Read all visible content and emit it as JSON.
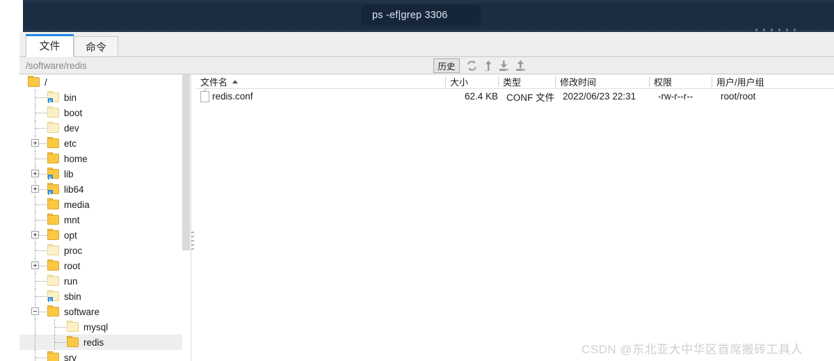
{
  "terminal": {
    "tab_title": "ps -ef|grep 3306"
  },
  "tabs": [
    {
      "id": "files",
      "label": "文件",
      "active": true
    },
    {
      "id": "commands",
      "label": "命令",
      "active": false
    }
  ],
  "toolbar": {
    "path_value": "/software/redis",
    "path_placeholder": "/software/redis",
    "history_label": "历史",
    "icons": [
      {
        "name": "refresh-icon",
        "title": "刷新"
      },
      {
        "name": "parent-directory-icon",
        "title": "上级目录"
      },
      {
        "name": "download-icon",
        "title": "下载"
      },
      {
        "name": "upload-icon",
        "title": "上传"
      }
    ]
  },
  "tree": {
    "items": [
      {
        "label": "/",
        "depth": 0,
        "expander": "none",
        "folder": "solid",
        "link": false,
        "selected": false
      },
      {
        "label": "bin",
        "depth": 1,
        "expander": "none",
        "folder": "pale",
        "link": true,
        "selected": false
      },
      {
        "label": "boot",
        "depth": 1,
        "expander": "none",
        "folder": "pale",
        "link": false,
        "selected": false
      },
      {
        "label": "dev",
        "depth": 1,
        "expander": "none",
        "folder": "pale",
        "link": false,
        "selected": false
      },
      {
        "label": "etc",
        "depth": 1,
        "expander": "plus",
        "folder": "solid",
        "link": false,
        "selected": false
      },
      {
        "label": "home",
        "depth": 1,
        "expander": "none",
        "folder": "solid",
        "link": false,
        "selected": false
      },
      {
        "label": "lib",
        "depth": 1,
        "expander": "plus",
        "folder": "solid",
        "link": true,
        "selected": false
      },
      {
        "label": "lib64",
        "depth": 1,
        "expander": "plus",
        "folder": "solid",
        "link": true,
        "selected": false
      },
      {
        "label": "media",
        "depth": 1,
        "expander": "none",
        "folder": "solid",
        "link": false,
        "selected": false
      },
      {
        "label": "mnt",
        "depth": 1,
        "expander": "none",
        "folder": "solid",
        "link": false,
        "selected": false
      },
      {
        "label": "opt",
        "depth": 1,
        "expander": "plus",
        "folder": "solid",
        "link": false,
        "selected": false
      },
      {
        "label": "proc",
        "depth": 1,
        "expander": "none",
        "folder": "pale",
        "link": false,
        "selected": false
      },
      {
        "label": "root",
        "depth": 1,
        "expander": "plus",
        "folder": "solid",
        "link": false,
        "selected": false
      },
      {
        "label": "run",
        "depth": 1,
        "expander": "none",
        "folder": "pale",
        "link": false,
        "selected": false
      },
      {
        "label": "sbin",
        "depth": 1,
        "expander": "none",
        "folder": "pale",
        "link": true,
        "selected": false
      },
      {
        "label": "software",
        "depth": 1,
        "expander": "minus",
        "folder": "solid",
        "link": false,
        "selected": false
      },
      {
        "label": "mysql",
        "depth": 2,
        "expander": "none",
        "folder": "pale",
        "link": false,
        "selected": false
      },
      {
        "label": "redis",
        "depth": 2,
        "expander": "none",
        "folder": "solid",
        "link": false,
        "selected": true
      },
      {
        "label": "srv",
        "depth": 1,
        "expander": "none",
        "folder": "solid",
        "link": false,
        "selected": false
      }
    ]
  },
  "file_list": {
    "columns": [
      {
        "key": "name",
        "label": "文件名",
        "sort": "asc"
      },
      {
        "key": "size",
        "label": "大小",
        "sort": "none"
      },
      {
        "key": "type",
        "label": "类型",
        "sort": "none"
      },
      {
        "key": "mtime",
        "label": "修改时间",
        "sort": "none"
      },
      {
        "key": "perm",
        "label": "权限",
        "sort": "none"
      },
      {
        "key": "owner",
        "label": "用户/用户组",
        "sort": "none"
      }
    ],
    "rows": [
      {
        "name": "redis.conf",
        "size": "62.4 KB",
        "type": "CONF 文件",
        "mtime": "2022/06/23 22:31",
        "perm": "-rw-r--r--",
        "owner": "root/root",
        "icon": "file-icon"
      }
    ]
  },
  "watermark": {
    "text": "CSDN @东北亚大中华区首席搬砖工具人"
  },
  "colors": {
    "terminal_bg": "#1e3349",
    "terminal_tab_bg": "#16263a",
    "accent": "#1e88e5",
    "toolbar_bg": "#eeeeee",
    "selection_bg": "#eeeeee",
    "folder_yellow": "#fbc844",
    "watermark": "#cfcfcf"
  }
}
